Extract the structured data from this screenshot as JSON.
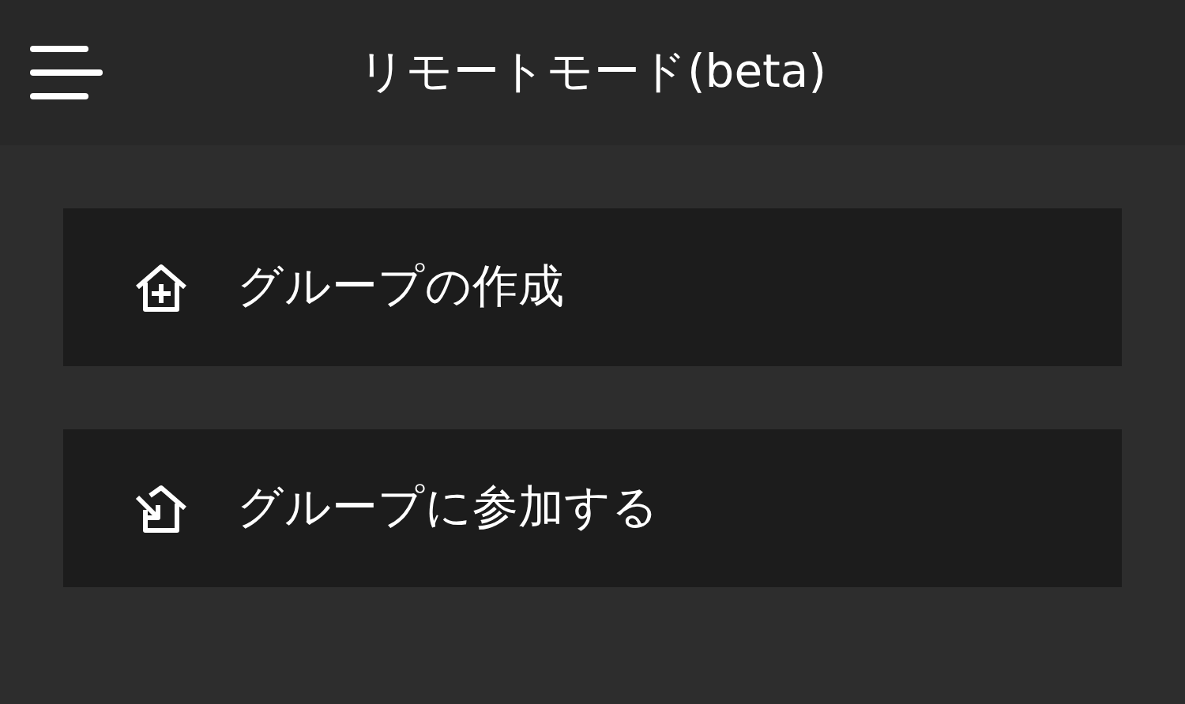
{
  "header": {
    "title": "リモートモード(beta)"
  },
  "actions": [
    {
      "kind": "create",
      "label": "グループの作成"
    },
    {
      "kind": "join",
      "label": "グループに参加する"
    }
  ]
}
